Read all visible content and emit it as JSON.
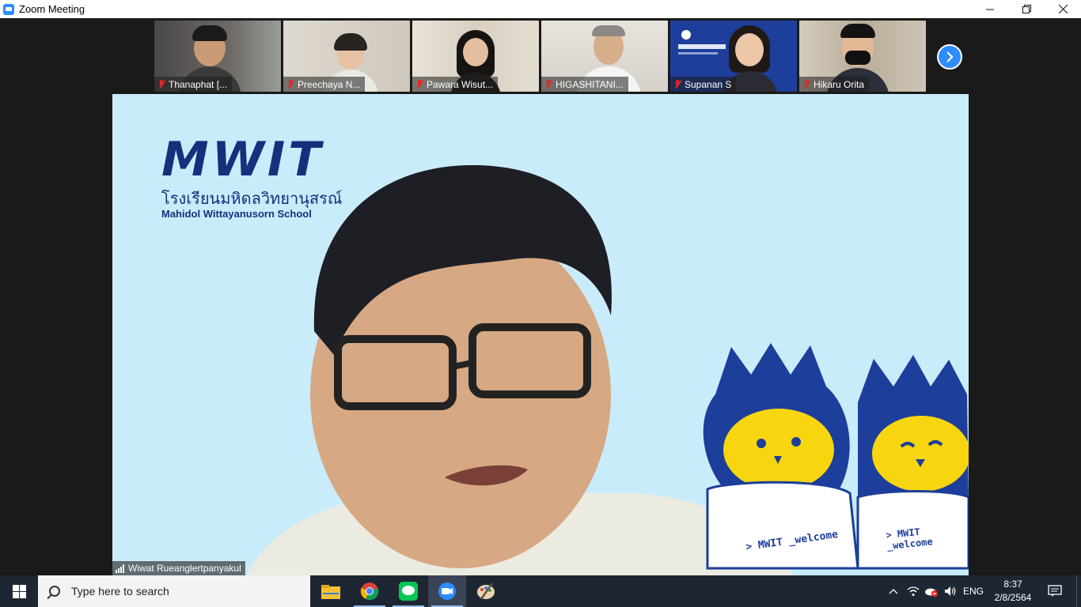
{
  "window": {
    "title": "Zoom Meeting"
  },
  "participants": [
    {
      "name": "Thanaphat [...",
      "muted": true
    },
    {
      "name": "Preechaya N...",
      "muted": true
    },
    {
      "name": "Pawara Wisut...",
      "muted": true
    },
    {
      "name": "HIGASHITANI...",
      "muted": true
    },
    {
      "name": "Supanan S",
      "muted": true
    },
    {
      "name": "Hikaru Orita",
      "muted": true
    }
  ],
  "active_speaker": {
    "name": "Wiwat Rueanglertpanyakul",
    "background": {
      "logo": "MWIT",
      "school_thai": "โรงเรียนมหิดลวิทยานุสรณ์",
      "school_en": "Mahidol Wittayanusorn School",
      "mascot_text_1": "> MWIT _welcome",
      "mascot_text_2": "> MWIT _welcome"
    }
  },
  "taskbar": {
    "search_placeholder": "Type here to search",
    "language": "ENG",
    "time": "8:37",
    "date": "2/8/2564"
  },
  "colors": {
    "zoom_blue": "#2d8cff",
    "muted_red": "#e02828",
    "mwit_navy": "#17307c",
    "main_bg": "#c9ecfb"
  }
}
